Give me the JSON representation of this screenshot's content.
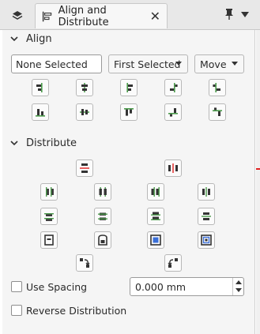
{
  "tabs": {
    "layers_icon": "layers-icon",
    "active_title": "Align and Distribute",
    "close_glyph": "✕"
  },
  "align": {
    "section_label": "Align",
    "selection_text": "None Selected",
    "relative_to": "First Selected",
    "mode": "Move"
  },
  "distribute": {
    "section_label": "Distribute",
    "use_spacing_label": "Use Spacing",
    "spacing_value": "0.000 mm",
    "reverse_label": "Reverse Distribution"
  },
  "colors": {
    "accent_green": "#4a9a4a",
    "icon_dark": "#333333",
    "accent_red": "#e02020",
    "accent_blue": "#3a6fd8"
  }
}
